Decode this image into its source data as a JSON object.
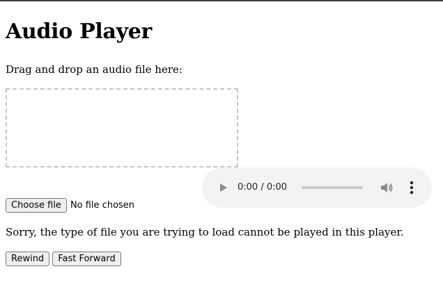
{
  "page": {
    "title": "Audio Player",
    "drop_label": "Drag and drop an audio file here:",
    "error_message": "Sorry, the type of file you are trying to load cannot be played in this player."
  },
  "audio": {
    "time": "0:00 / 0:00",
    "play_icon": "play-icon",
    "volume_icon": "volume-icon",
    "more_icon": "more-vert-icon",
    "progress": 0,
    "background_color": "#f1f3f4"
  },
  "file_input": {
    "button_label": "Choose file",
    "status": "No file chosen"
  },
  "controls": {
    "rewind_label": "Rewind",
    "fast_forward_label": "Fast Forward"
  }
}
